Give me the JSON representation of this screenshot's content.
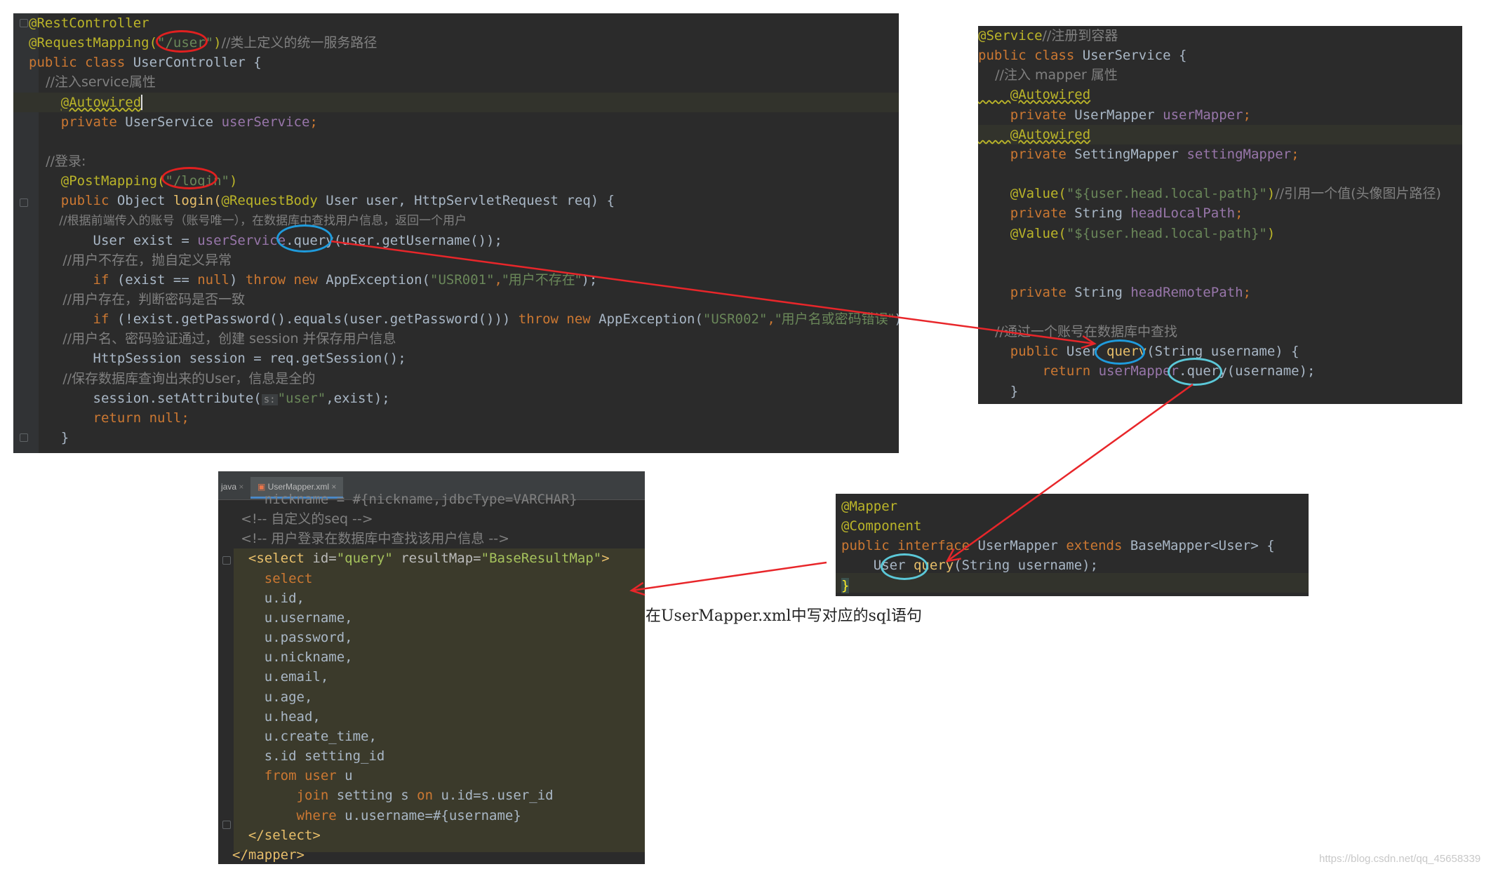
{
  "controller": {
    "lines": {
      "l1": "@RestController",
      "l2a": "@RequestMapping(",
      "l2b": "\"/user\"",
      "l2c": ")",
      "l2d": "//类上定义的统一服务路径",
      "l3a": "public class",
      "l3b": " UserController {",
      "l4": "    //注入service属性",
      "l5": "@Autowired",
      "l6a": "    private",
      "l6b": " UserService ",
      "l6c": "userService",
      "l6d": ";",
      "l8": "    //登录:",
      "l9a": "    @PostMapping(",
      "l9b": "\"/login\"",
      "l9c": ")",
      "l10a": "    public",
      "l10b": " Object ",
      "l10c": "login(",
      "l10d": "@RequestBody",
      "l10e": " User user, HttpServletRequest req) {",
      "l11": "        //根据前端传入的账号（账号唯一），在数据库中查找用户信息，返回一个用户",
      "l12a": "        User exist = ",
      "l12b": "userService",
      "l12c": ".query(user.getUsername());",
      "l13": "        //用户不存在，抛自定义异常",
      "l14a": "        if",
      "l14b": " (exist == ",
      "l14c": "null",
      "l14d": ") ",
      "l14e": "throw new",
      "l14f": " AppException(",
      "l14g": "\"USR001\"",
      "l14h": ",",
      "l14i": "\"用户不存在\"",
      "l14j": ");",
      "l15": "        //用户存在，判断密码是否一致",
      "l16a": "        if",
      "l16b": " (!exist.getPassword().equals(user.getPassword())) ",
      "l16c": "throw new",
      "l16d": " AppException(",
      "l16e": "\"USR002\"",
      "l16f": ",",
      "l16g": "\"用户名或密码错误\"",
      "l16h": ");",
      "l17": "        //用户名、密码验证通过，创建 session 并保存用户信息",
      "l18": "        HttpSession session = req.getSession();",
      "l19": "        //保存数据库查询出来的User，信息是全的",
      "l20a": "        session.setAttribute(",
      "l20hint": "s:",
      "l20b": "\"user\"",
      "l20c": ",exist);",
      "l21a": "        return",
      "l21b": " null",
      "l21c": ";",
      "l22": "    }"
    }
  },
  "service": {
    "lines": {
      "l1a": "@Service",
      "l1b": "//注册到容器",
      "l2a": "public class",
      "l2b": " UserService {",
      "l3": "    //注入 mapper 属性",
      "l4": "    @Autowired",
      "l5a": "    private",
      "l5b": " UserMapper ",
      "l5c": "userMapper",
      "l5d": ";",
      "l6": "    @Autowired",
      "l7a": "    private",
      "l7b": " SettingMapper ",
      "l7c": "settingMapper",
      "l7d": ";",
      "l9a": "    @Value(",
      "l9b": "\"${user.head.local-path}\"",
      "l9c": ")",
      "l9d": "//引用一个值(头像图片路径)",
      "l10a": "    private",
      "l10b": " String ",
      "l10c": "headLocalPath",
      "l10d": ";",
      "l11a": "    @Value(",
      "l11b": "\"${user.head.local-path}\"",
      "l11c": ")",
      "l14a": "    private",
      "l14b": " String ",
      "l14c": "headRemotePath",
      "l14d": ";",
      "l16": "    //通过一个账号在数据库中查找",
      "l17a": "    public",
      "l17b": " User ",
      "l17c": "query",
      "l17d": "(String username) {",
      "l18a": "        return",
      "l18b": " userMapper",
      "l18c": ".query(username);",
      "l19": "    }"
    }
  },
  "mapper": {
    "lines": {
      "l1": "@Mapper",
      "l2": "@Component",
      "l3a": "public interface",
      "l3b": " UserMapper ",
      "l3c": "extends",
      "l3d": " BaseMapper<User> {",
      "l4a": "    User ",
      "l4b": "query",
      "l4c": "(String username);",
      "l5": "}"
    }
  },
  "xml": {
    "tabs": {
      "prev": "java",
      "active": "UserMapper.xml"
    },
    "lines": {
      "l0": "    nickname = #{nickname,jdbcType=VARCHAR}",
      "l1": "  <!-- 自定义的seq -->",
      "l2": "  <!-- 用户登录在数据库中查找该用户信息 -->",
      "l3a": "  <select",
      "l3b": " id=",
      "l3c": "\"query\"",
      "l3d": " resultMap=",
      "l3e": "\"BaseResultMap\"",
      "l3f": ">",
      "l4": "    select",
      "l5": "    u.id,",
      "l6": "    u.username,",
      "l7": "    u.password,",
      "l8": "    u.nickname,",
      "l9": "    u.email,",
      "l10": "    u.age,",
      "l11": "    u.head,",
      "l12": "    u.create_time,",
      "l13": "    s.id setting_id",
      "l14a": "    from",
      "l14b": " user",
      "l14c": " u",
      "l15a": "        join",
      "l15b": " setting s ",
      "l15c": "on",
      "l15d": " u.id=s.user_id",
      "l16a": "        where",
      "l16b": " u.username=#{username}",
      "l17": "  </select>",
      "l18": "</mapper>"
    }
  },
  "annotation": {
    "caption": "在UserMapper.xml中写对应的sql语句",
    "arrow_color": "#e8262a",
    "ring_red": "#e02020",
    "ring_blue": "#1f9bdc",
    "ring_cyan": "#5bc8d8"
  },
  "watermark": "https://blog.csdn.net/qq_45658339"
}
